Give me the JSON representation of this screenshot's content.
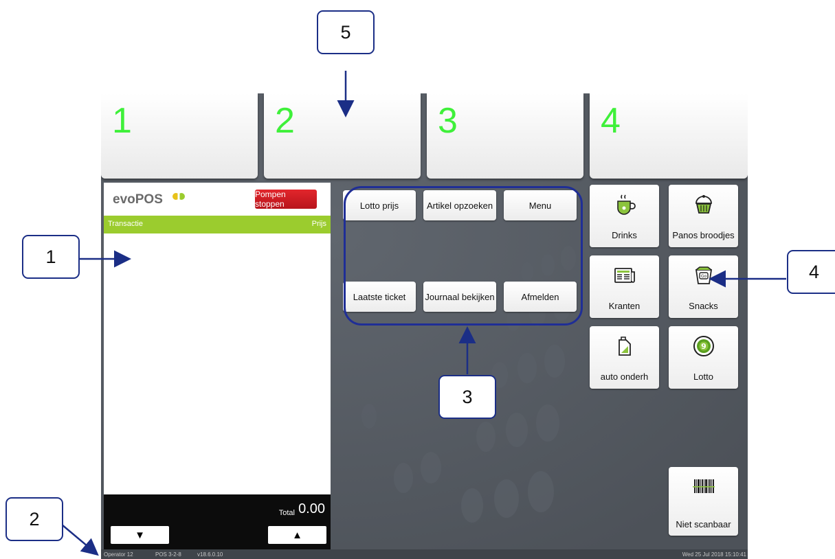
{
  "pumps": [
    {
      "number": "1"
    },
    {
      "number": "2"
    },
    {
      "number": "3"
    },
    {
      "number": "4"
    }
  ],
  "transaction": {
    "logo_text": "evoPOS",
    "stop_button": "Pompen stoppen",
    "col_transaction": "Transactie",
    "col_price": "Prijs",
    "total_label": "Total",
    "total_value": "0.00",
    "scroll_down": "▼",
    "scroll_up": "▲"
  },
  "functions": [
    {
      "label": "Lotto prijs"
    },
    {
      "label": "Artikel opzoeken"
    },
    {
      "label": "Menu"
    },
    {
      "label": "Laatste ticket"
    },
    {
      "label": "Journaal bekijken"
    },
    {
      "label": "Afmelden"
    }
  ],
  "categories": [
    {
      "label": "Drinks",
      "icon": "coffee-cup-icon"
    },
    {
      "label": "Panos broodjes",
      "icon": "cupcake-icon"
    },
    {
      "label": "Kranten",
      "icon": "newspaper-icon"
    },
    {
      "label": "Snacks",
      "icon": "snack-bag-icon"
    },
    {
      "label": "auto onderh",
      "icon": "oil-can-icon"
    },
    {
      "label": "Lotto",
      "icon": "lotto-ball-icon"
    }
  ],
  "no_scan_button": {
    "label": "Niet scanbaar",
    "icon": "barcode-icon"
  },
  "status": {
    "operator": "Operator 12",
    "pos": "POS 3-2-8",
    "version": "v18.6.0.10",
    "datetime": "Wed 25 Jul 2018 15:10:41"
  },
  "callouts": [
    "5",
    "1",
    "4",
    "3",
    "2"
  ],
  "colors": {
    "pump_number": "#3ff03a",
    "header_green": "#9bcc2e",
    "stop_red": "#d01c22",
    "annotation_blue": "#1b2e86",
    "background": "#555b63"
  }
}
